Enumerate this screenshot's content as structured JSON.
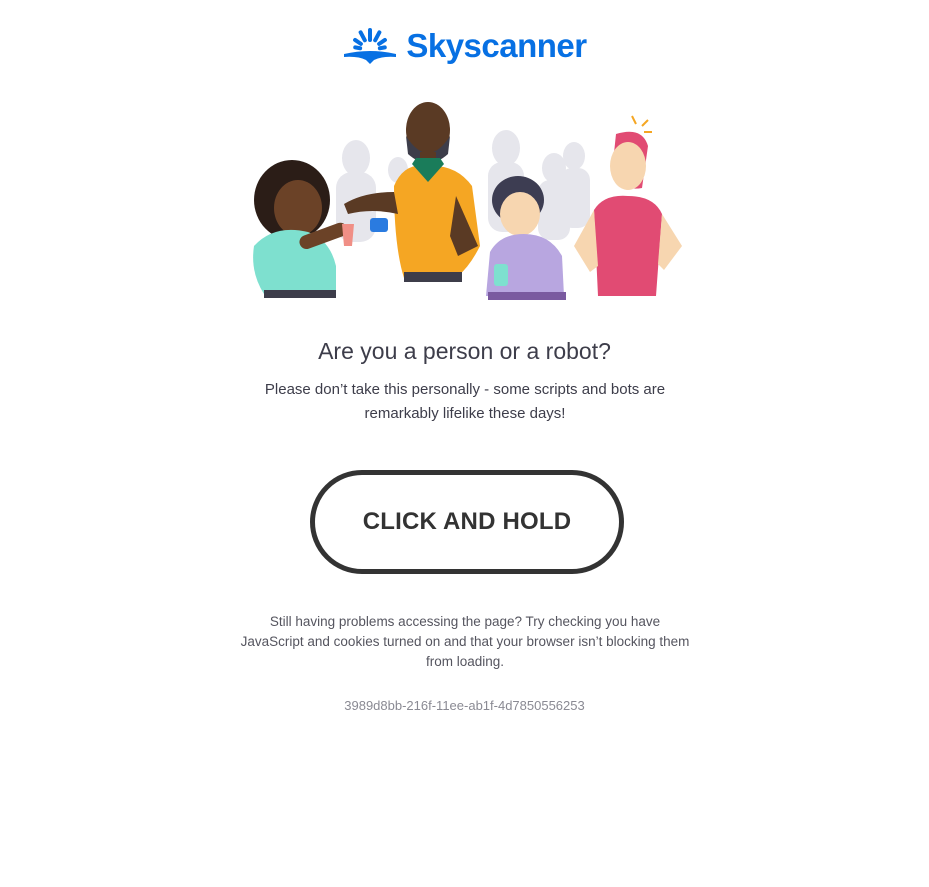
{
  "brand": {
    "name": "Skyscanner",
    "color": "#0770e3",
    "logo_icon": "sunrise-icon"
  },
  "illustration": {
    "icon": "people-group-illustration"
  },
  "challenge": {
    "title": "Are you a person or a robot?",
    "description": "Please don’t take this personally - some scripts and bots are remarkably lifelike these days!",
    "button_label": "CLICK AND HOLD"
  },
  "help": {
    "text": "Still having problems accessing the page? Try checking you have JavaScript and cookies turned on and that your browser isn’t blocking them from loading."
  },
  "request_id": "3989d8bb-216f-11ee-ab1f-4d7850556253"
}
